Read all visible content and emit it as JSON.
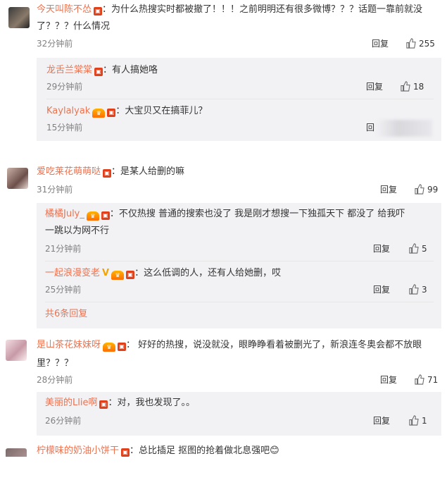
{
  "comments": [
    {
      "user": "今天叫陈不怂",
      "text_line1": "：为什么热搜实时都被撤了！！！之前明明还有很多微博？？？话题一靠前就没",
      "text_line2": "了？？？什么情况",
      "time": "32分钟前",
      "reply": "回复",
      "likes": "255",
      "replies": [
        {
          "user": "龙舌兰棠棠",
          "text": "：有人搞她咯",
          "time": "29分钟前",
          "reply": "回复",
          "likes": "18"
        },
        {
          "user": "Kaylalyak",
          "text": "：大宝贝又在搞菲儿？",
          "time": "15分钟前",
          "reply": "回"
        }
      ]
    },
    {
      "user": "爱吃莱花萌萌哒",
      "text": "：是某人给删的嘛",
      "time": "31分钟前",
      "reply": "回复",
      "likes": "99",
      "replies": [
        {
          "user": "橘橘July_",
          "text_line1": "：不仅热搜  普通的搜索也没了   我是刚才想搜一下独孤天下  都没了  给我吓",
          "text_line2": "一跳以为网不行",
          "time": "21分钟前",
          "reply": "回复",
          "likes": "5"
        },
        {
          "user": "一起浪漫变老",
          "vmark": "V",
          "text": "：这么低调的人，还有人给她删，哎",
          "time": "25分钟前",
          "reply": "回复",
          "likes": "3"
        }
      ],
      "more": "共6条回复"
    },
    {
      "user": "是山茶花妹妹呀",
      "text_line1": "：  好好的热搜，说没就没，眼睁睁看着被删光了，新浪连冬奥会都不放眼",
      "text_line2": "里？？？",
      "time": "28分钟前",
      "reply": "回复",
      "likes": "71",
      "replies": [
        {
          "user": "美丽的Llie啊",
          "text": "：对，我也发现了。。",
          "time": "26分钟前",
          "reply": "回复",
          "likes": "1"
        }
      ]
    },
    {
      "user": "柠檬味的奶油小饼干",
      "text": "：总比插足   抠图的抢着做北息强吧😊"
    }
  ],
  "icons": {
    "badge": "red-envelope-badge-icon",
    "vip": "vip-crown-icon",
    "like": "thumbs-up-icon"
  },
  "colors": {
    "username": "#eb7350",
    "reply_bg": "#f2f2f5",
    "time": "#808080"
  }
}
